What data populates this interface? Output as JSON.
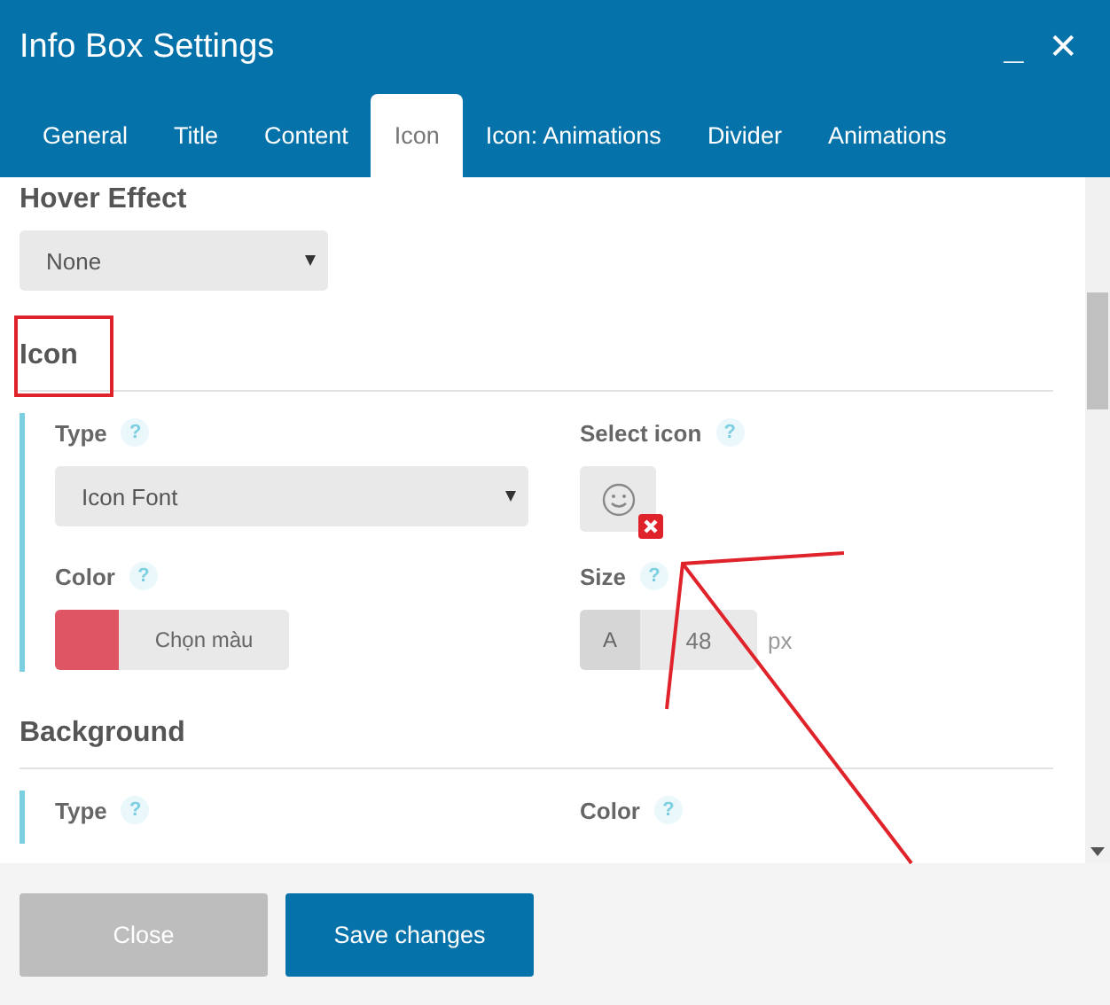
{
  "window": {
    "title": "Info Box Settings",
    "controls": [
      {
        "kind": "minimize",
        "label": "_"
      },
      {
        "kind": "close",
        "label": "✕"
      }
    ]
  },
  "tabs": [
    {
      "label": "General",
      "selected": false
    },
    {
      "label": "Title",
      "selected": false
    },
    {
      "label": "Content",
      "selected": false
    },
    {
      "label": "Icon",
      "selected": true
    },
    {
      "label": "Icon: Animations",
      "selected": false
    },
    {
      "label": "Divider",
      "selected": false
    },
    {
      "label": "Animations",
      "selected": false
    }
  ],
  "sections": [
    {
      "heading": "Hover Effect",
      "fields": [
        {
          "kind": "select",
          "value": "None"
        }
      ]
    },
    {
      "heading": "Icon",
      "highlighted": true,
      "group": [
        {
          "kind": "select",
          "label": "Type",
          "help": "?",
          "value": "Icon Font"
        },
        {
          "kind": "icon_picker",
          "label": "Select icon",
          "help": "?"
        },
        {
          "kind": "color",
          "label": "Color",
          "help": "?",
          "color": "#e05563",
          "button": "Chọn màu"
        },
        {
          "kind": "number",
          "label": "Size",
          "help": "?",
          "prefix": "A",
          "value": "48",
          "unit": "px"
        }
      ]
    },
    {
      "heading": "Background",
      "highlighted": false,
      "group": [
        {
          "kind": "label",
          "label": "Type",
          "help": "?"
        },
        {
          "kind": "label",
          "label": "Color",
          "help": "?"
        }
      ]
    }
  ],
  "buttons": [
    {
      "label": "Close",
      "primary": false
    },
    {
      "label": "Save changes",
      "primary": true
    }
  ]
}
